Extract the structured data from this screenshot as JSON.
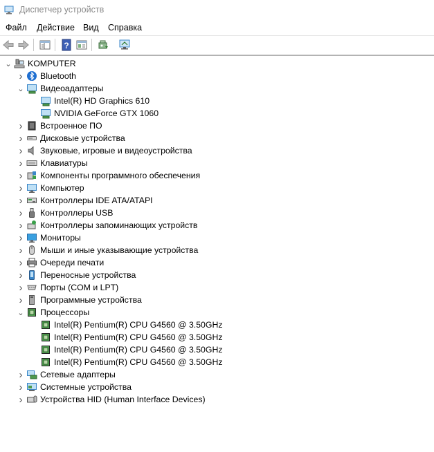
{
  "window": {
    "title": "Диспетчер устройств"
  },
  "menu": [
    "Файл",
    "Действие",
    "Вид",
    "Справка"
  ],
  "toolbar": [
    {
      "name": "back-button",
      "icon": "arrow-left-icon"
    },
    {
      "name": "forward-button",
      "icon": "arrow-right-icon"
    },
    {
      "name": "properties-view-button",
      "icon": "properties-icon"
    },
    {
      "name": "help-button",
      "icon": "help-icon"
    },
    {
      "name": "show-hide-button",
      "icon": "console-tree-icon"
    },
    {
      "name": "update-driver-button",
      "icon": "update-driver-icon"
    },
    {
      "name": "scan-hardware-button",
      "icon": "monitor-scan-icon"
    }
  ],
  "tree": {
    "root": "KOMPUTER",
    "items": [
      {
        "label": "Bluetooth",
        "level": 1,
        "state": "collapsed",
        "icon": "bluetooth-icon"
      },
      {
        "label": "Видеоадаптеры",
        "level": 1,
        "state": "expanded",
        "icon": "display-adapter-icon"
      },
      {
        "label": "Intel(R) HD Graphics 610",
        "level": 2,
        "state": "leaf",
        "icon": "display-adapter-icon"
      },
      {
        "label": "NVIDIA GeForce GTX 1060",
        "level": 2,
        "state": "leaf",
        "icon": "display-adapter-icon"
      },
      {
        "label": "Встроенное ПО",
        "level": 1,
        "state": "collapsed",
        "icon": "firmware-icon"
      },
      {
        "label": "Дисковые устройства",
        "level": 1,
        "state": "collapsed",
        "icon": "disk-drive-icon"
      },
      {
        "label": "Звуковые, игровые и видеоустройства",
        "level": 1,
        "state": "collapsed",
        "icon": "speaker-icon"
      },
      {
        "label": "Клавиатуры",
        "level": 1,
        "state": "collapsed",
        "icon": "keyboard-icon"
      },
      {
        "label": "Компоненты программного обеспечения",
        "level": 1,
        "state": "collapsed",
        "icon": "software-component-icon"
      },
      {
        "label": "Компьютер",
        "level": 1,
        "state": "collapsed",
        "icon": "computer-icon"
      },
      {
        "label": "Контроллеры IDE ATA/ATAPI",
        "level": 1,
        "state": "collapsed",
        "icon": "ide-controller-icon"
      },
      {
        "label": "Контроллеры USB",
        "level": 1,
        "state": "collapsed",
        "icon": "usb-icon"
      },
      {
        "label": "Контроллеры запоминающих устройств",
        "level": 1,
        "state": "collapsed",
        "icon": "storage-controller-icon"
      },
      {
        "label": "Мониторы",
        "level": 1,
        "state": "collapsed",
        "icon": "monitor-icon"
      },
      {
        "label": "Мыши и иные указывающие устройства",
        "level": 1,
        "state": "collapsed",
        "icon": "mouse-icon"
      },
      {
        "label": "Очереди печати",
        "level": 1,
        "state": "collapsed",
        "icon": "printer-icon"
      },
      {
        "label": "Переносные устройства",
        "level": 1,
        "state": "collapsed",
        "icon": "portable-device-icon"
      },
      {
        "label": "Порты (COM и LPT)",
        "level": 1,
        "state": "collapsed",
        "icon": "port-icon"
      },
      {
        "label": "Программные устройства",
        "level": 1,
        "state": "collapsed",
        "icon": "software-device-icon"
      },
      {
        "label": "Процессоры",
        "level": 1,
        "state": "expanded",
        "icon": "processor-icon"
      },
      {
        "label": "Intel(R) Pentium(R) CPU G4560 @ 3.50GHz",
        "level": 2,
        "state": "leaf",
        "icon": "processor-icon"
      },
      {
        "label": "Intel(R) Pentium(R) CPU G4560 @ 3.50GHz",
        "level": 2,
        "state": "leaf",
        "icon": "processor-icon"
      },
      {
        "label": "Intel(R) Pentium(R) CPU G4560 @ 3.50GHz",
        "level": 2,
        "state": "leaf",
        "icon": "processor-icon"
      },
      {
        "label": "Intel(R) Pentium(R) CPU G4560 @ 3.50GHz",
        "level": 2,
        "state": "leaf",
        "icon": "processor-icon"
      },
      {
        "label": "Сетевые адаптеры",
        "level": 1,
        "state": "collapsed",
        "icon": "network-adapter-icon"
      },
      {
        "label": "Системные устройства",
        "level": 1,
        "state": "collapsed",
        "icon": "system-device-icon"
      },
      {
        "label": "Устройства HID (Human Interface Devices)",
        "level": 1,
        "state": "collapsed",
        "icon": "hid-icon"
      }
    ]
  }
}
